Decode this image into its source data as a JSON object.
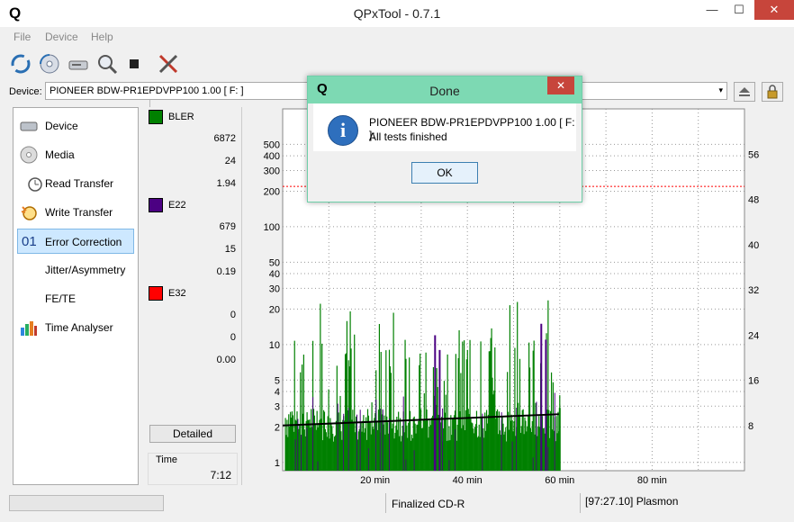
{
  "window": {
    "title": "QPxTool - 0.7.1",
    "logo": "Q",
    "minimize": "—",
    "maximize": "☐",
    "close": "✕"
  },
  "menu": [
    "File",
    "Device",
    "Help"
  ],
  "toolbar": {
    "icons": [
      "refresh-icon",
      "disc-scan-icon",
      "device-icon",
      "search-disc-icon",
      "stop-icon",
      "tools-icon"
    ]
  },
  "device": {
    "label": "Device:",
    "value": "PIONEER  BDW-PR1EPDVPP100 1.00 [ F: ]",
    "arrow": "▾"
  },
  "nav": [
    {
      "label": "Device",
      "icon": "drive-icon",
      "active": false
    },
    {
      "label": "Media",
      "icon": "disc-icon",
      "active": false
    },
    {
      "label": "Read Transfer",
      "icon": "clock-icon",
      "active": false
    },
    {
      "label": "Write Transfer",
      "icon": "burn-clock-icon",
      "active": false
    },
    {
      "label": "Error Correction",
      "icon": "01-icon",
      "active": true
    },
    {
      "label": "Jitter/Asymmetry",
      "icon": "none",
      "active": false
    },
    {
      "label": "FE/TE",
      "icon": "none",
      "active": false
    },
    {
      "label": "Time Analyser",
      "icon": "bar-chart-icon",
      "active": false
    }
  ],
  "stats": {
    "groups": [
      {
        "name": "BLER",
        "color": "#008000",
        "values": [
          "6872",
          "24",
          "1.94"
        ]
      },
      {
        "name": "E22",
        "color": "#4b0082",
        "values": [
          "679",
          "15",
          "0.19"
        ]
      },
      {
        "name": "E32",
        "color": "#ff0000",
        "values": [
          "0",
          "0",
          "0.00"
        ]
      }
    ],
    "detailed_label": "Detailed",
    "time_label": "Time",
    "time_value": "7:12"
  },
  "chart_data": {
    "type": "bar",
    "y_left_scale": "log",
    "y_left_ticks": [
      "1",
      "2",
      "3",
      "4",
      "5",
      "10",
      "20",
      "30",
      "40",
      "50",
      "100",
      "200",
      "300",
      "400",
      "500"
    ],
    "y_right_ticks": [
      "8",
      "16",
      "24",
      "32",
      "40",
      "48",
      "56"
    ],
    "x_ticks": [
      "20 min",
      "40 min",
      "60 min",
      "80 min"
    ],
    "x_range_min": [
      0,
      100
    ],
    "data_end_min": 60,
    "threshold_level": 220,
    "threshold_color": "#ff0000",
    "speed_line_color": "#000000",
    "speed_line": {
      "x_min": [
        0,
        60
      ],
      "y_speed_x": [
        8.0,
        10.0
      ]
    },
    "series": [
      {
        "name": "BLER",
        "color": "#008000"
      },
      {
        "name": "E22",
        "color": "#4b0082"
      }
    ]
  },
  "dialog": {
    "title": "Done",
    "logo": "Q",
    "close": "✕",
    "info": "i",
    "line1": "PIONEER  BDW-PR1EPDVPP100 1.00 [ F: ]:",
    "line2": "All tests finished",
    "ok": "OK"
  },
  "status": {
    "media": "Finalized CD-R",
    "mid": "[97:27.10] Plasmon"
  }
}
